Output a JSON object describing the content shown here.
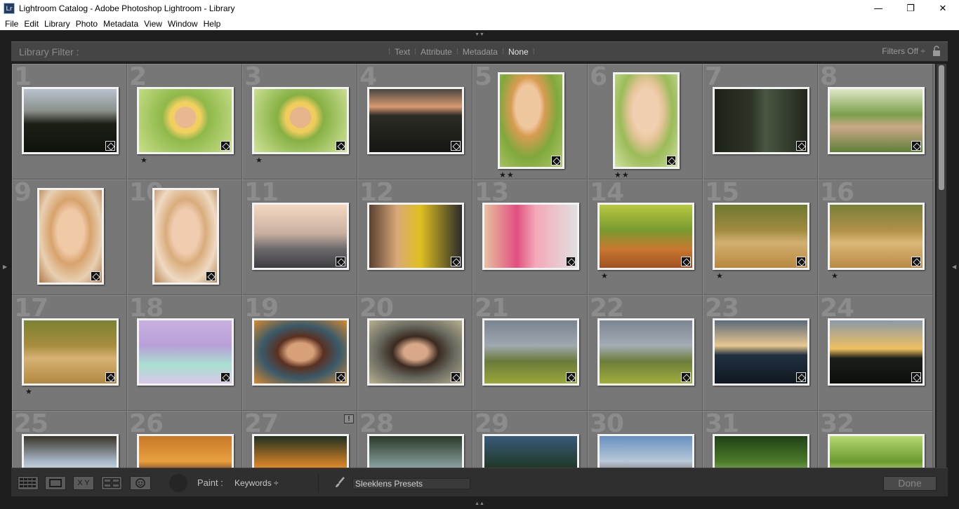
{
  "window": {
    "app_icon": "Lr",
    "title": "Lightroom Catalog - Adobe Photoshop Lightroom - Library",
    "minimize": "—",
    "maximize": "❐",
    "close": "✕"
  },
  "menu": [
    "File",
    "Edit",
    "Library",
    "Photo",
    "Metadata",
    "View",
    "Window",
    "Help"
  ],
  "filter": {
    "title": "Library Filter :",
    "options": [
      "Text",
      "Attribute",
      "Metadata",
      "None"
    ],
    "active": "None",
    "preset": "Filters Off ÷"
  },
  "grid": {
    "cells": [
      {
        "num": "1",
        "stars": ""
      },
      {
        "num": "2",
        "stars": "★"
      },
      {
        "num": "3",
        "stars": "★"
      },
      {
        "num": "4",
        "stars": ""
      },
      {
        "num": "5",
        "stars": "★★"
      },
      {
        "num": "6",
        "stars": "★★"
      },
      {
        "num": "7",
        "stars": ""
      },
      {
        "num": "8",
        "stars": ""
      },
      {
        "num": "9",
        "stars": ""
      },
      {
        "num": "10",
        "stars": ""
      },
      {
        "num": "11",
        "stars": ""
      },
      {
        "num": "12",
        "stars": ""
      },
      {
        "num": "13",
        "stars": ""
      },
      {
        "num": "14",
        "stars": "★"
      },
      {
        "num": "15",
        "stars": "★"
      },
      {
        "num": "16",
        "stars": "★"
      },
      {
        "num": "17",
        "stars": "★"
      },
      {
        "num": "18",
        "stars": ""
      },
      {
        "num": "19",
        "stars": ""
      },
      {
        "num": "20",
        "stars": ""
      },
      {
        "num": "21",
        "stars": ""
      },
      {
        "num": "22",
        "stars": ""
      },
      {
        "num": "23",
        "stars": ""
      },
      {
        "num": "24",
        "stars": ""
      },
      {
        "num": "25",
        "stars": ""
      },
      {
        "num": "26",
        "stars": ""
      },
      {
        "num": "27",
        "stars": "",
        "warning": "!"
      },
      {
        "num": "28",
        "stars": ""
      },
      {
        "num": "29",
        "stars": ""
      },
      {
        "num": "30",
        "stars": ""
      },
      {
        "num": "31",
        "stars": ""
      },
      {
        "num": "32",
        "stars": ""
      }
    ]
  },
  "toolbar": {
    "grid_view_icon": "grid-view-icon",
    "loupe_view_icon": "loupe-view-icon",
    "compare_label": "X Y",
    "survey_view_icon": "survey-view-icon",
    "people_view_icon": "people-view-icon",
    "paint_label": "Paint :",
    "keywords_label": "Keywords ÷",
    "preset_value": "Sleeklens Presets",
    "done_label": "Done"
  }
}
